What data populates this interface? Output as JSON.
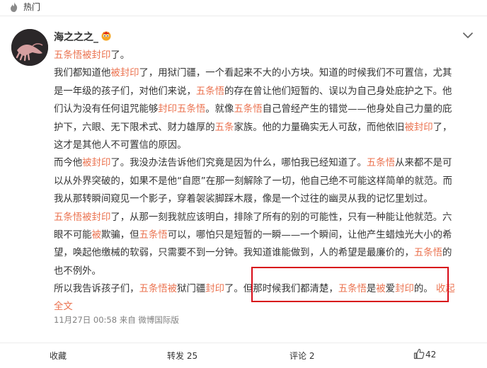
{
  "hot_bar": {
    "label": "热门",
    "icon": "fire-icon"
  },
  "post": {
    "username": "海之之之_",
    "vip_badge": "vip-badge-icon",
    "menu_icon": "chevron-down-icon",
    "title": [
      "五条悟被封印",
      "了。"
    ],
    "lines": [
      [
        "我们都知道他",
        "被封印",
        "了，用狱门疆，一个看起来不大的小方块。知道的时候我们不可置信，尤其"
      ],
      [
        "是一年级的孩子们，对他们来说，",
        "五条悟",
        "的存在曾让他们短暂的、误以为自己身处庇护之下。他"
      ],
      [
        "们认为没有任何诅咒能够",
        "封印五条悟",
        "。就像",
        "五条悟",
        "自己曾经产生的错觉——他身处自己力量的庇"
      ],
      [
        "护下，六眼、无下限术式、财力雄厚的",
        "五条",
        "家族。他的力量确实无人可敌，而他依旧",
        "被封印",
        "了，"
      ],
      [
        "这才是其他人不可置信的原因。"
      ],
      [
        "而今他",
        "被封印",
        "了。我没办法告诉他们究竟是因为什么，哪怕我已经知道了。",
        "五条悟",
        "从来都不是可"
      ],
      [
        "以从外界突破的，如果不是他“自愿”在那一刻解除了一切，他自己绝不可能这样简单的就范。而"
      ],
      [
        "我从那转瞬间窥见一个影子，穿着袈裟脚踩木屐，像是一个过往的幽灵从我的记忆里划过。"
      ],
      [
        "五条悟被封印",
        "了，从那一刻我就应该明白，排除了所有的别的可能性，只有一种能让他就范。六"
      ],
      [
        "眼不可能",
        "被",
        "欺骗，但",
        "五条悟",
        "可以，哪怕只是短暂的一瞬——一个瞬间，让他产生蜡烛光大小的希"
      ],
      [
        "望，唤起他缴械的软弱，只需要不到一分钟。我知道谁能做到，人的希望是最廉价的，",
        "五条悟",
        "的"
      ],
      [
        "也不例外。"
      ],
      [
        "所以我告诉孩子们，",
        "五条悟被",
        "狱门疆",
        "封印",
        "了。但那时候我们都清楚，",
        "五条悟",
        "是",
        "被",
        "爱",
        "封印",
        "的。"
      ]
    ],
    "collapse": "收起",
    "fulltext": "全文",
    "meta": "11月27日 00:58  来自 微博国际版"
  },
  "actions": {
    "collect": "收藏",
    "repost": "转发 25",
    "comment": "评论 2",
    "like_count": "42",
    "like_icon": "thumbs-up-icon"
  },
  "accent_color": "#eb7350",
  "highlight_box_color": "#d80c18"
}
